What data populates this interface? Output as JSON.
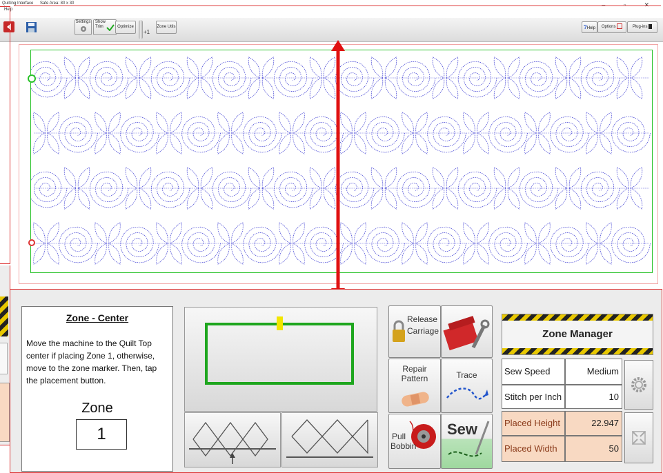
{
  "window": {
    "title": "Quilting Interface",
    "safe_area": "Safe Area: 80 x 30",
    "menu_help": "Help",
    "controls": "–  ▫  ✕"
  },
  "toolbar": {
    "settings": "Settings",
    "show_trim": "Show Trim",
    "optimize": "Optimize",
    "plus_one": "+1",
    "zone_utils": "Zone Utils",
    "help": "Help",
    "options": "Options",
    "plugins": "Plug-ins"
  },
  "zone_panel": {
    "title": "Zone - Center",
    "description": "Move the machine to the Quilt Top center if placing Zone 1, otherwise, move to the zone marker. Then, tap the placement button.",
    "zone_label": "Zone",
    "zone_value": "1"
  },
  "actions": {
    "release_carriage": [
      "Release",
      "Carriage"
    ],
    "repair_pattern": [
      "Repair",
      "Pattern"
    ],
    "trace": "Trace",
    "pull_bobbin": [
      "Pull",
      "Bobbin"
    ],
    "sew": "Sew"
  },
  "zone_manager": {
    "title": "Zone Manager",
    "rows": [
      {
        "label": "Sew Speed",
        "value": "Medium"
      },
      {
        "label": "Stitch per Inch",
        "value": "10"
      },
      {
        "label": "Placed Height",
        "value": "22.947"
      },
      {
        "label": "Placed Width",
        "value": "50"
      }
    ]
  },
  "colors": {
    "quilt_outline": "#28c228",
    "pattern_stitch": "#4a4ad6",
    "marker_red": "#e01010",
    "zone_outline": "#1ea61e",
    "zone_marker": "#f2e600"
  }
}
